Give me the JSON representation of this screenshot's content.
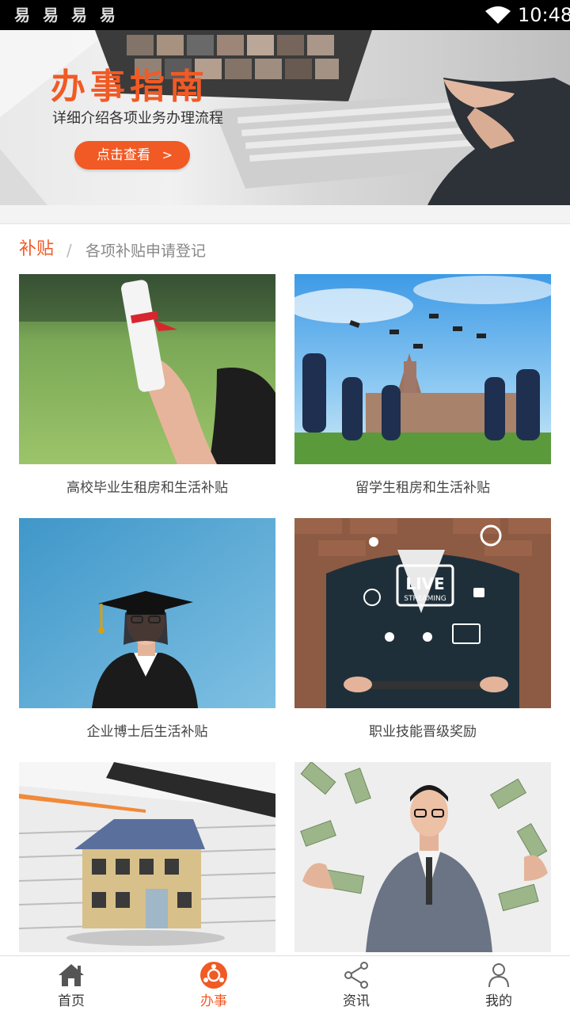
{
  "status_bar": {
    "app_icons": [
      "易",
      "易",
      "易",
      "易"
    ],
    "time": "10:48"
  },
  "banner": {
    "title": "办事指南",
    "subtitle": "详细介绍各项业务办理流程",
    "button_label": "点击查看",
    "button_chevron": ">"
  },
  "section": {
    "title": "补贴",
    "separator": "/",
    "subtitle": "各项补贴申请登记"
  },
  "cards": [
    {
      "caption": "高校毕业生租房和生活补贴"
    },
    {
      "caption": "留学生租房和生活补贴"
    },
    {
      "caption": "企业博士后生活补贴"
    },
    {
      "caption": "职业技能晋级奖励"
    },
    {
      "caption": ""
    },
    {
      "caption": ""
    }
  ],
  "thumb_text": {
    "live": "LIVE",
    "streaming": "STREAMING"
  },
  "tabs": [
    {
      "label": "首页",
      "icon": "home-icon",
      "active": false
    },
    {
      "label": "办事",
      "icon": "service-icon",
      "active": true
    },
    {
      "label": "资讯",
      "icon": "share-icon",
      "active": false
    },
    {
      "label": "我的",
      "icon": "user-icon",
      "active": false
    }
  ],
  "colors": {
    "accent": "#f15a24",
    "status_bar": "#000000",
    "text": "#444444",
    "muted": "#888888"
  }
}
